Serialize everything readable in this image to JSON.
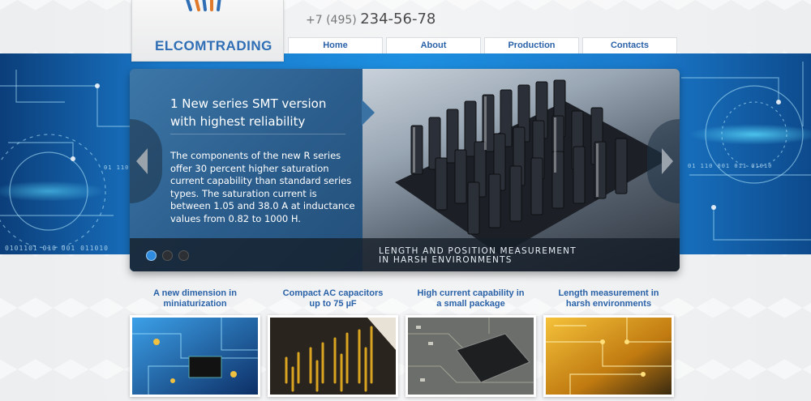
{
  "header": {
    "logo_text": "ELCOMTRADING",
    "phone_code": "+7 (495)",
    "phone_number": "234-56-78"
  },
  "nav": {
    "items": [
      {
        "label": "Home"
      },
      {
        "label": "About"
      },
      {
        "label": "Production"
      },
      {
        "label": "Contacts"
      }
    ]
  },
  "banner": {
    "binary_left_1": "01  110",
    "binary_left_2": "0101101  010  001  011010",
    "binary_right": "01  110  001  011  01010"
  },
  "slider": {
    "title": "1 New series SMT version with highest reliability",
    "body": "The components of the new R series offer 30 percent higher saturation current capability than standard series types. The saturation current is between 1.05 and 38.0 A at inductance values from 0.82 to 1000 H.",
    "caption_line1": "LENGTH AND POSITION MEASUREMENT",
    "caption_line2": "IN HARSH ENVIRONMENTS",
    "slide_count": 3,
    "active_slide": 1
  },
  "features": [
    {
      "title_line1": "A new dimension in",
      "title_line2": "miniaturization"
    },
    {
      "title_line1": "Compact AC capacitors",
      "title_line2": "up to 75 µF"
    },
    {
      "title_line1": "High current capability in",
      "title_line2": "a small package"
    },
    {
      "title_line1": "Length measurement in",
      "title_line2": "harsh environments"
    }
  ],
  "colors": {
    "link_blue": "#2a62a8",
    "banner_blue": "#1d8fe0",
    "slider_panel": "#2b5d8c",
    "dot_active": "#2f8be0"
  }
}
